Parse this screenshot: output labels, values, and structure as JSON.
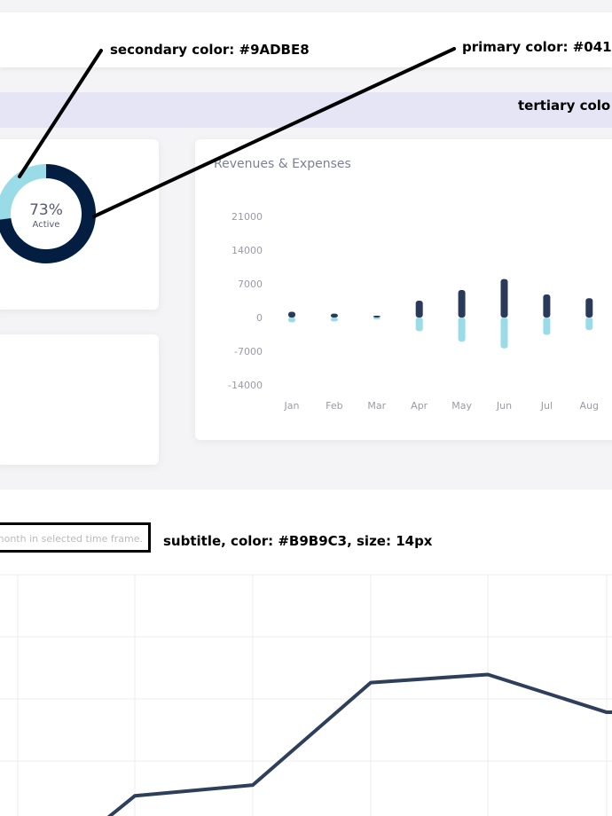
{
  "annotations": {
    "secondary_color": "secondary color: #9ADBE8",
    "primary_color": "primary color: #041",
    "tertiary_color": "tertiary colo",
    "subtitle_spec": "subtitle, color: #B9B9C3, size: 14px"
  },
  "colors": {
    "primary": "#041E42",
    "secondary": "#9ADBE8",
    "tertiary": "#E6E5F6",
    "subtitle": "#B9B9C3",
    "line": "#2E3F5C"
  },
  "donut": {
    "percent": 73,
    "percent_label": "73%",
    "label": "Active"
  },
  "bar_chart": {
    "title": "Revenues & Expenses",
    "chart_data": {
      "type": "bar",
      "categories": [
        "Jan",
        "Feb",
        "Mar",
        "Apr",
        "May",
        "Jun",
        "Jul",
        "Aug"
      ],
      "series": [
        {
          "values": [
            1200,
            800,
            400,
            3500,
            5700,
            8000,
            4800,
            4000
          ]
        },
        {
          "values": [
            -1000,
            -800,
            -400,
            -2800,
            -5000,
            -6400,
            -3600,
            -2600
          ]
        }
      ],
      "yticks": [
        21000,
        14000,
        7000,
        0,
        -7000,
        -14000
      ],
      "ylim": [
        -14000,
        21000
      ]
    }
  },
  "line_chart": {
    "subtitle": "month in selected time frame.",
    "chart_data": {
      "type": "line",
      "values": [
        10,
        18,
        22,
        60,
        63,
        49
      ],
      "ylim": [
        0,
        100
      ]
    }
  }
}
